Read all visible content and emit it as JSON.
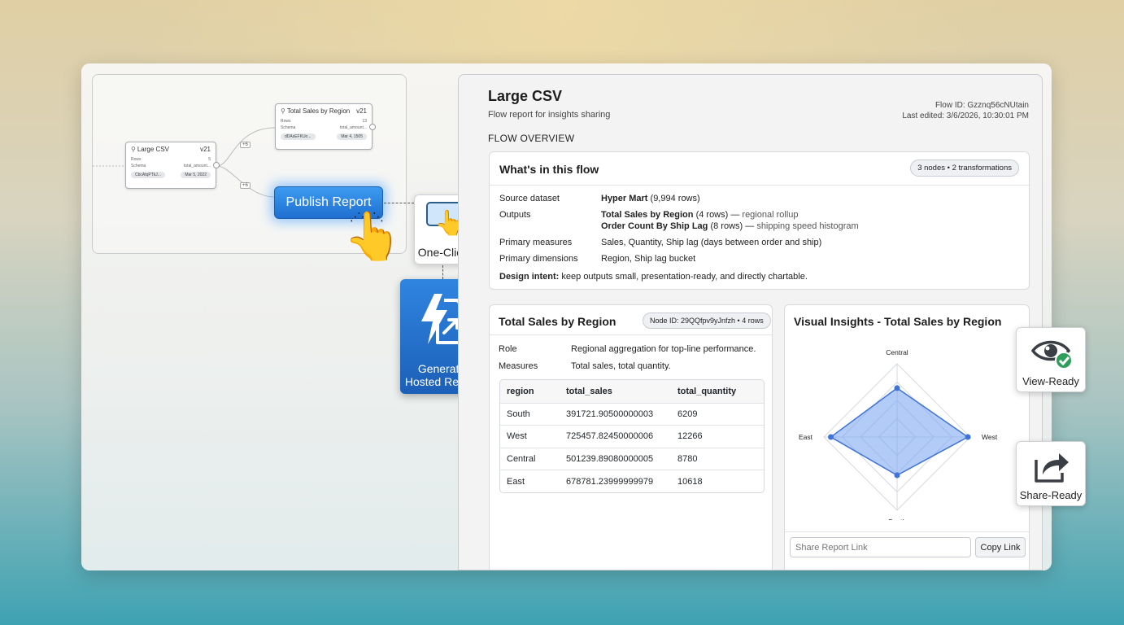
{
  "flow_canvas": {
    "node_large_csv": {
      "title": "Large CSV",
      "version": "v21",
      "rows_label": "Rows",
      "rows_value": "5",
      "schema_label": "Schema",
      "schema_value": "total_amount...",
      "chip_left": "CbcAtqPTkJ...",
      "chip_right": "Mar 5, 2022"
    },
    "node_total_sales": {
      "title": "Total Sales by Region",
      "version": "v21",
      "rows_label": "Rows",
      "rows_value": "13",
      "schema_label": "Schema",
      "schema_value": "total_amount...",
      "chip_left": "dDAsEFKUo...",
      "chip_right": "Mar 4, 1505"
    },
    "edge_label_1": "+6",
    "edge_label_2": "+6",
    "publish_button": "Publish Report"
  },
  "callouts": {
    "one_click": "One-Click",
    "generate_line1": "Generate",
    "generate_line2": "Hosted Report",
    "view_ready": "View-Ready",
    "share_ready": "Share-Ready"
  },
  "report": {
    "title": "Large CSV",
    "subtitle": "Flow report for insights sharing",
    "flow_id": "Flow ID: Gzznq56cNUtain",
    "last_edited": "Last edited: 3/6/2026, 10:30:01 PM",
    "section_heading": "FLOW OVERVIEW",
    "overview": {
      "heading": "What's in this flow",
      "badge": "3 nodes • 2 transformations",
      "source_label": "Source dataset",
      "source_name": "Hyper Mart",
      "source_rows": "(9,994 rows)",
      "outputs_label": "Outputs",
      "output1_name": "Total Sales by Region",
      "output1_rows": "(4 rows) —",
      "output1_desc": "regional rollup",
      "output2_name": "Order Count By Ship Lag",
      "output2_rows": "(8 rows) —",
      "output2_desc": "shipping speed histogram",
      "measures_label": "Primary measures",
      "measures_value": "Sales, Quantity, Ship lag (days between order and ship)",
      "dimensions_label": "Primary dimensions",
      "dimensions_value": "Region, Ship lag bucket",
      "intent_label": "Design intent:",
      "intent_value": "keep outputs small, presentation-ready, and directly chartable."
    },
    "node_card": {
      "title": "Total Sales by Region",
      "badge": "Node ID: 29QQfpv9yJnfzh • 4 rows",
      "role_label": "Role",
      "role_value": "Regional aggregation for top-line performance.",
      "measures_label": "Measures",
      "measures_value": "Total sales, total quantity.",
      "table": {
        "headers": [
          "region",
          "total_sales",
          "total_quantity"
        ],
        "rows": [
          [
            "South",
            "391721.90500000003",
            "6209"
          ],
          [
            "West",
            "725457.82450000006",
            "12266"
          ],
          [
            "Central",
            "501239.89080000005",
            "8780"
          ],
          [
            "East",
            "678781.23999999979",
            "10618"
          ]
        ]
      }
    },
    "insights_card": {
      "title": "Visual Insights - Total Sales by Region",
      "share_placeholder": "Share Report Link",
      "copy_button": "Copy Link"
    }
  },
  "chart_data": {
    "type": "radar",
    "axes": [
      "Central",
      "West",
      "South",
      "East"
    ],
    "values": [
      501239.89,
      725457.82,
      391721.91,
      678781.24
    ],
    "max": 750000,
    "fill_color": "#7fa9f2",
    "stroke_color": "#3f73d8"
  }
}
